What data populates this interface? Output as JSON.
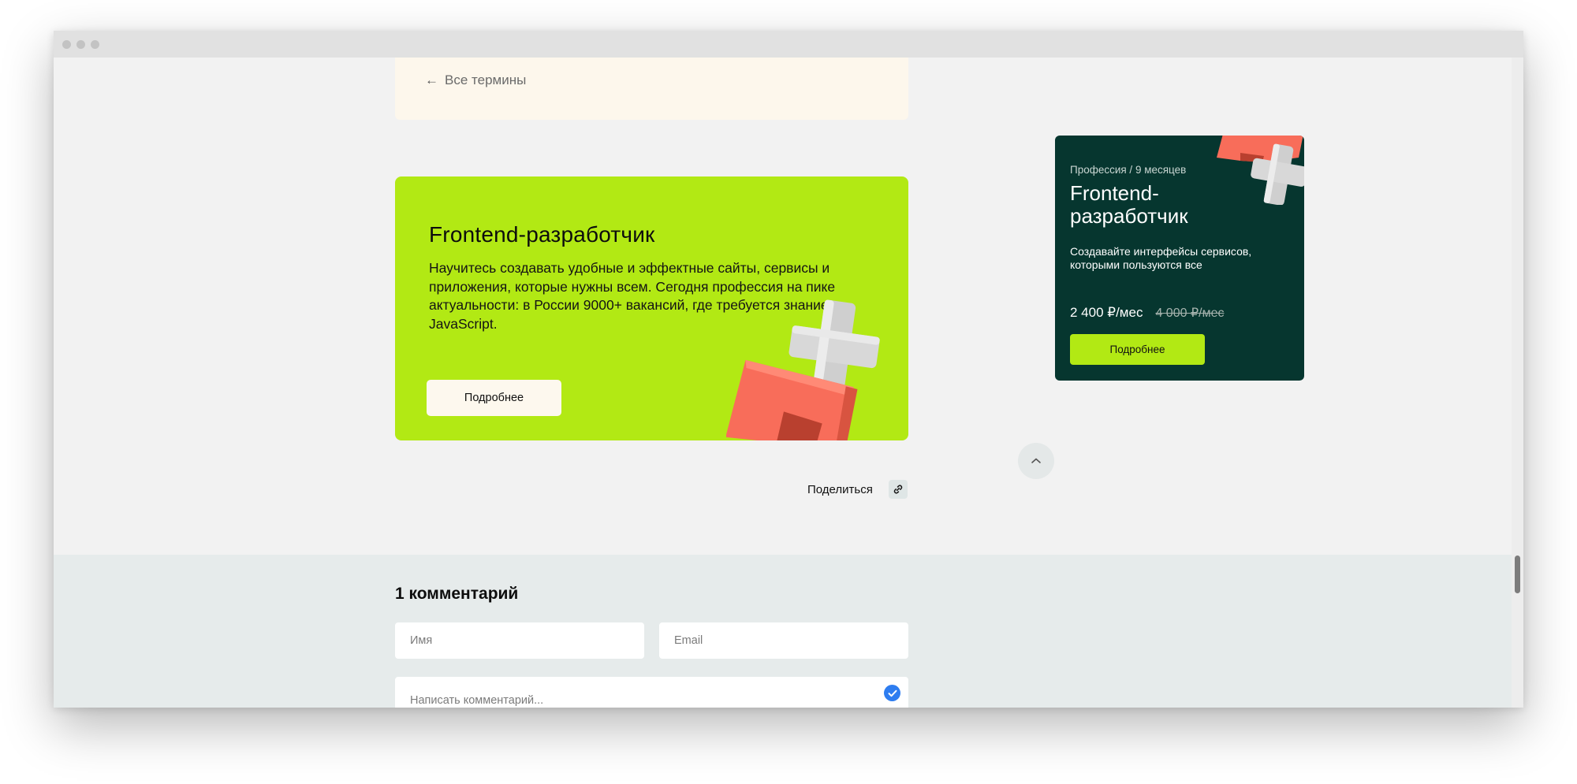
{
  "article": {
    "back_link": "Все термины"
  },
  "promo": {
    "title": "Frontend-разработчик",
    "description": "Научитесь создавать удобные и эффектные сайты, сервисы и приложения, которые нужны всем. Сегодня профессия на пике актуальности: в России 9000+ вакансий, где требуется знание JavaScript.",
    "button_label": "Подробнее",
    "background_color": "#b2e914"
  },
  "share": {
    "label": "Поделиться",
    "icon": "link-icon"
  },
  "scroll_top": {
    "icon": "chevron-up-icon"
  },
  "sidebar_card": {
    "meta": "Профессия / 9 месяцев",
    "title": "Frontend-разработчик",
    "description": "Создавайте интерфейсы сервисов, которыми пользуются все",
    "price_current": "2 400 ₽/мес",
    "price_old": "4 000 ₽/мес",
    "button_label": "Подробнее",
    "background_color": "#06362f",
    "accent_color": "#b2e914"
  },
  "comments": {
    "title": "1 комментарий",
    "name_placeholder": "Имя",
    "email_placeholder": "Email",
    "comment_placeholder": "Написать комментарий...",
    "check_icon": "checkmark-icon",
    "check_color": "#2e7df0"
  }
}
